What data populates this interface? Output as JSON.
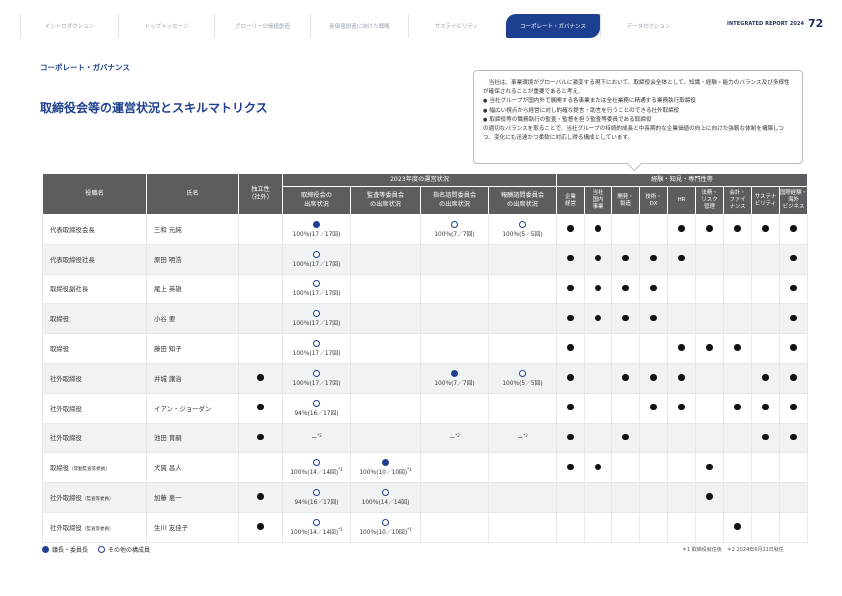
{
  "nav": {
    "tabs": [
      "イントロダクション",
      "トップメッセージ",
      "グローリーの価値創造",
      "新価値創造に向けた戦略",
      "サステナビリティ",
      "コーポレート・ガバナンス",
      "データセクション"
    ],
    "active_index": 5,
    "report_label": "INTEGRATED REPORT 2024",
    "page_number": "72"
  },
  "section_label": "コーポレート・ガバナンス",
  "page_title": "取締役会等の運営状況とスキルマトリクス",
  "callout": {
    "intro": "当社は、事業環境がグローバルに激変する現下において、取締役会全体として、知識・経験・能力のバランス及び多様性が確保されることが重要であると考え、",
    "bullets": [
      "当社グループが国内外で展開する各事業または全社業務に精通する業務執行取締役",
      "幅広い視点から経営に対し的確な提言・助言を行うことのできる社外取締役",
      "取締役等の職務執行の監査・監督を担う監査等委員である取締役"
    ],
    "outro": "の適切なバランスを取ることで、当社グループの持続的成長と中長期的な企業価値の向上に向けた強靭な体制を構築しつつ、変化にも迅速かつ柔軟に対応し得る構成としています。"
  },
  "table": {
    "header_group_attendance": "2023年度の運営状況",
    "header_group_skills": "経験・知見・専門性等",
    "col_role": "役職名",
    "col_name": "氏名",
    "col_independent": "独立性\n（社外）",
    "col_attendance": [
      "取締役会の\n出席状況",
      "監査等委員会\nの出席状況",
      "指名諮問委員会\nの出席状況",
      "報酬諮問委員会\nの出席状況"
    ],
    "col_skills": [
      "企業\n経営",
      "当社\n国内\n事業",
      "開発・\n製造",
      "技術・\nDX",
      "HR",
      "法務・\nリスク\n管理",
      "会計・\nファイ\nナンス",
      "サステナ\nビリティ",
      "国際経験・\n海外\nビジネス"
    ],
    "rows": [
      {
        "role": "代表取締役会長",
        "role_sub": "",
        "name": "三和 元純",
        "independent": false,
        "attendance": [
          {
            "mark": "filled",
            "text": "100％(17／17回)"
          },
          null,
          {
            "mark": "open",
            "text": "100％(7／7回)"
          },
          {
            "mark": "open",
            "text": "100％(5／5回)"
          }
        ],
        "skills": [
          1,
          1,
          0,
          0,
          1,
          1,
          1,
          1,
          1
        ]
      },
      {
        "role": "代表取締役社長",
        "role_sub": "",
        "name": "原田 明浩",
        "independent": false,
        "attendance": [
          {
            "mark": "open",
            "text": "100％(17／17回)"
          },
          null,
          null,
          null
        ],
        "skills": [
          1,
          1,
          1,
          1,
          1,
          0,
          0,
          0,
          1
        ]
      },
      {
        "role": "取締役副社長",
        "role_sub": "",
        "name": "尾上 英雄",
        "independent": false,
        "attendance": [
          {
            "mark": "open",
            "text": "100％(17／17回)"
          },
          null,
          null,
          null
        ],
        "skills": [
          1,
          1,
          1,
          1,
          0,
          0,
          0,
          0,
          1
        ]
      },
      {
        "role": "取締役",
        "role_sub": "",
        "name": "小谷 要",
        "independent": false,
        "attendance": [
          {
            "mark": "open",
            "text": "100％(17／17回)"
          },
          null,
          null,
          null
        ],
        "skills": [
          1,
          1,
          1,
          1,
          0,
          0,
          0,
          0,
          1
        ]
      },
      {
        "role": "取締役",
        "role_sub": "",
        "name": "藤田 知子",
        "independent": false,
        "attendance": [
          {
            "mark": "open",
            "text": "100％(17／17回)"
          },
          null,
          null,
          null
        ],
        "skills": [
          1,
          0,
          0,
          0,
          1,
          1,
          1,
          0,
          1
        ]
      },
      {
        "role": "社外取締役",
        "role_sub": "",
        "name": "井城 譲治",
        "independent": true,
        "attendance": [
          {
            "mark": "open",
            "text": "100％(17／17回)"
          },
          null,
          {
            "mark": "filled",
            "text": "100％(7／7回)"
          },
          {
            "mark": "open",
            "text": "100％(5／5回)"
          }
        ],
        "skills": [
          1,
          0,
          1,
          1,
          1,
          0,
          0,
          1,
          1
        ]
      },
      {
        "role": "社外取締役",
        "role_sub": "",
        "name": "イアン・ジョーダン",
        "independent": true,
        "attendance": [
          {
            "mark": "open",
            "text": "94％(16／17回)"
          },
          null,
          null,
          null
        ],
        "skills": [
          1,
          0,
          0,
          1,
          1,
          0,
          1,
          1,
          1
        ]
      },
      {
        "role": "社外取締役",
        "role_sub": "",
        "name": "池田 育嗣",
        "independent": true,
        "attendance": [
          {
            "mark": "none",
            "text": "ー",
            "note": "*2"
          },
          null,
          {
            "mark": "none",
            "text": "ー",
            "note": "*2"
          },
          {
            "mark": "none",
            "text": "ー",
            "note": "*2"
          }
        ],
        "skills": [
          1,
          0,
          1,
          0,
          0,
          0,
          0,
          1,
          1
        ]
      },
      {
        "role": "取締役",
        "role_sub": "（常勤監査等委員）",
        "name": "犬賀 昌人",
        "independent": false,
        "attendance": [
          {
            "mark": "open",
            "text": "100％(14／14回)",
            "note": "*1"
          },
          {
            "mark": "filled",
            "text": "100％(10／10回)",
            "note": "*1"
          },
          null,
          null
        ],
        "skills": [
          1,
          1,
          0,
          0,
          0,
          1,
          0,
          0,
          0
        ]
      },
      {
        "role": "社外取締役",
        "role_sub": "（監査等委員）",
        "name": "加藤 恵一",
        "independent": true,
        "attendance": [
          {
            "mark": "open",
            "text": "94％(16／17回)"
          },
          {
            "mark": "open",
            "text": "100％(14／14回)"
          },
          null,
          null
        ],
        "skills": [
          0,
          0,
          0,
          0,
          0,
          1,
          0,
          0,
          0
        ]
      },
      {
        "role": "社外取締役",
        "role_sub": "（監査等委員）",
        "name": "生川 友佳子",
        "independent": true,
        "attendance": [
          {
            "mark": "open",
            "text": "100％(14／14回)",
            "note": "*1"
          },
          {
            "mark": "open",
            "text": "100％(10／10回)",
            "note": "*1"
          },
          null,
          null
        ],
        "skills": [
          0,
          0,
          0,
          0,
          0,
          0,
          1,
          0,
          0
        ]
      }
    ]
  },
  "legend": {
    "filled": "議長・委員長",
    "open": "その他の構成員"
  },
  "notes": "＊1 取締役就任後　＊2 2024年6月21日就任",
  "colors": {
    "accent": "#1e3f8f",
    "header_bg": "#5b5d61"
  }
}
